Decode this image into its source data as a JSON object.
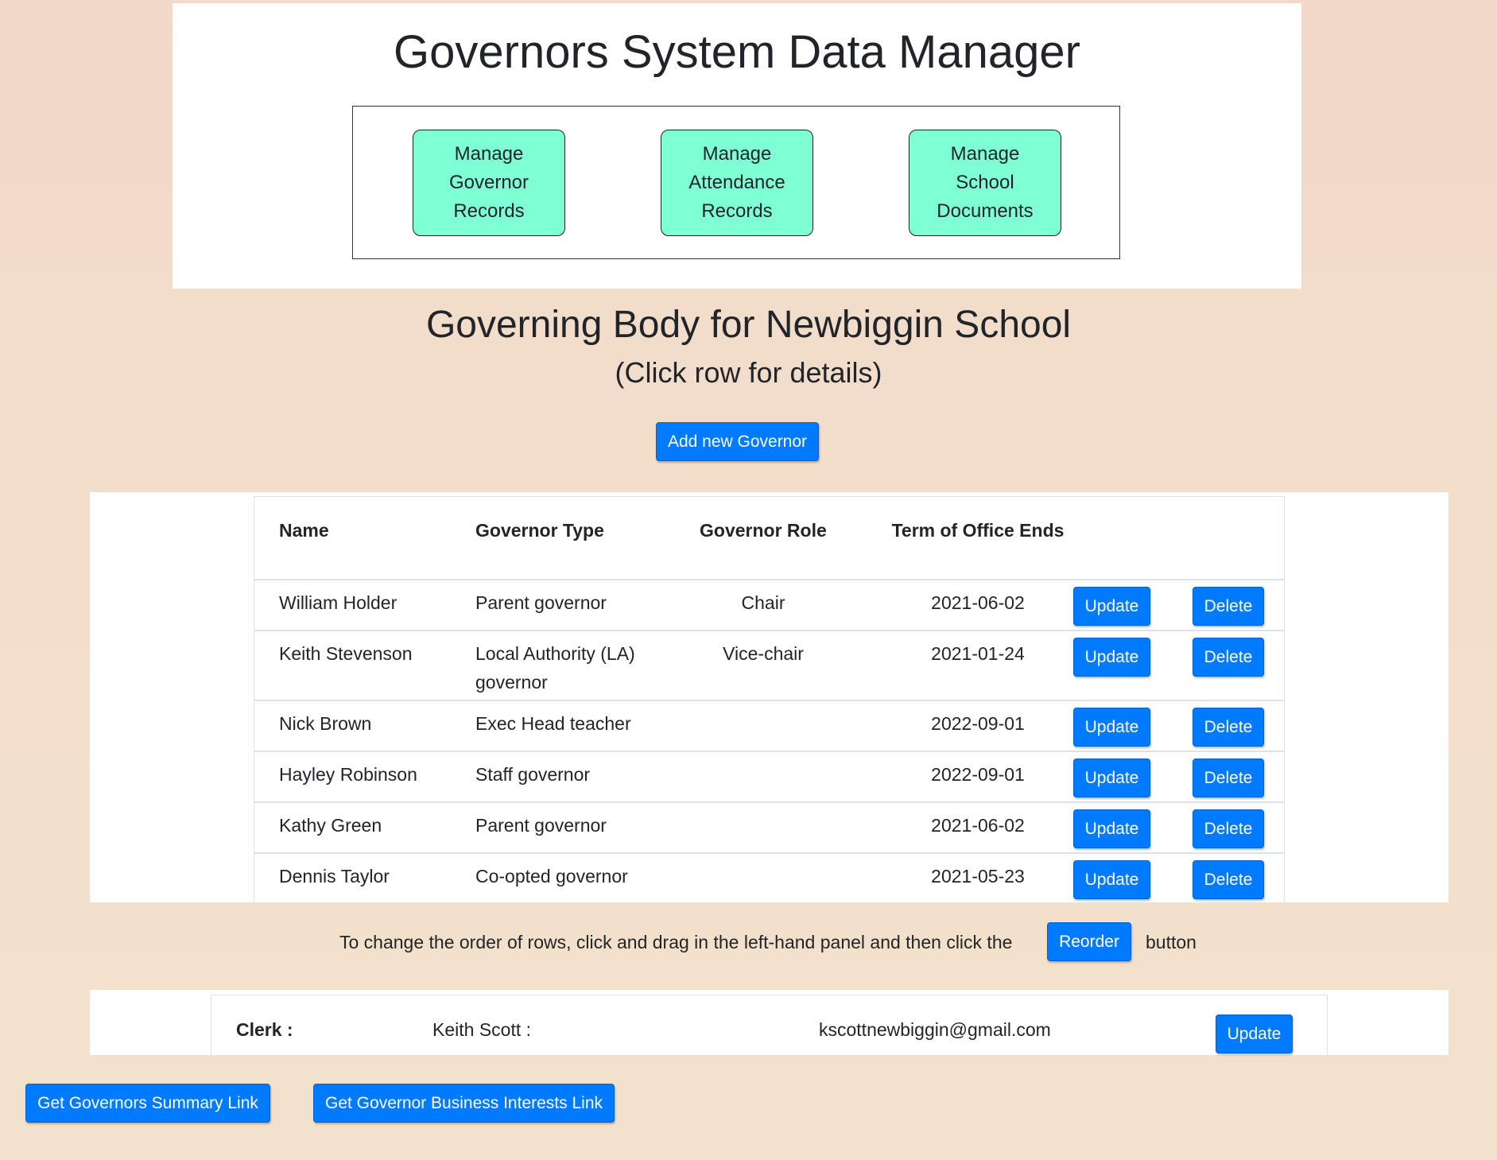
{
  "header": {
    "title": "Governors System Data Manager",
    "menu": [
      {
        "label": "Manage Governor Records"
      },
      {
        "label": "Manage Attendance Records"
      },
      {
        "label": "Manage School Documents"
      }
    ]
  },
  "main": {
    "title": "Governing Body for Newbiggin School",
    "subtitle": "(Click row for details)",
    "add_button": "Add new Governor"
  },
  "table": {
    "columns": [
      "Name",
      "Governor Type",
      "Governor Role",
      "Term of Office Ends"
    ],
    "update_label": "Update",
    "delete_label": "Delete",
    "rows": [
      {
        "name": "William Holder",
        "type": "Parent governor",
        "role": "Chair",
        "term": "2021-06-02"
      },
      {
        "name": "Keith Stevenson",
        "type": "Local Authority (LA) governor",
        "role": "Vice-chair",
        "term": "2021-01-24"
      },
      {
        "name": "Nick Brown",
        "type": "Exec Head teacher",
        "role": "",
        "term": "2022-09-01"
      },
      {
        "name": "Hayley Robinson",
        "type": "Staff governor",
        "role": "",
        "term": "2022-09-01"
      },
      {
        "name": "Kathy Green",
        "type": "Parent governor",
        "role": "",
        "term": "2021-06-02"
      },
      {
        "name": "Dennis Taylor",
        "type": "Co-opted governor",
        "role": "",
        "term": "2021-05-23"
      }
    ]
  },
  "reorder": {
    "text_before": "To change the order of rows, click and drag in the left-hand panel and then click the",
    "button": "Reorder",
    "text_after": "button"
  },
  "clerk": {
    "label": "Clerk :",
    "name": "Keith Scott :",
    "email": "kscottnewbiggin@gmail.com",
    "update_label": "Update"
  },
  "footer": {
    "summary_button": "Get Governors Summary Link",
    "interests_button": "Get Governor Business Interests Link"
  },
  "colors": {
    "primary": "#007bff",
    "menu_button": "#7fffd4",
    "page_background": "#f2dccb"
  }
}
